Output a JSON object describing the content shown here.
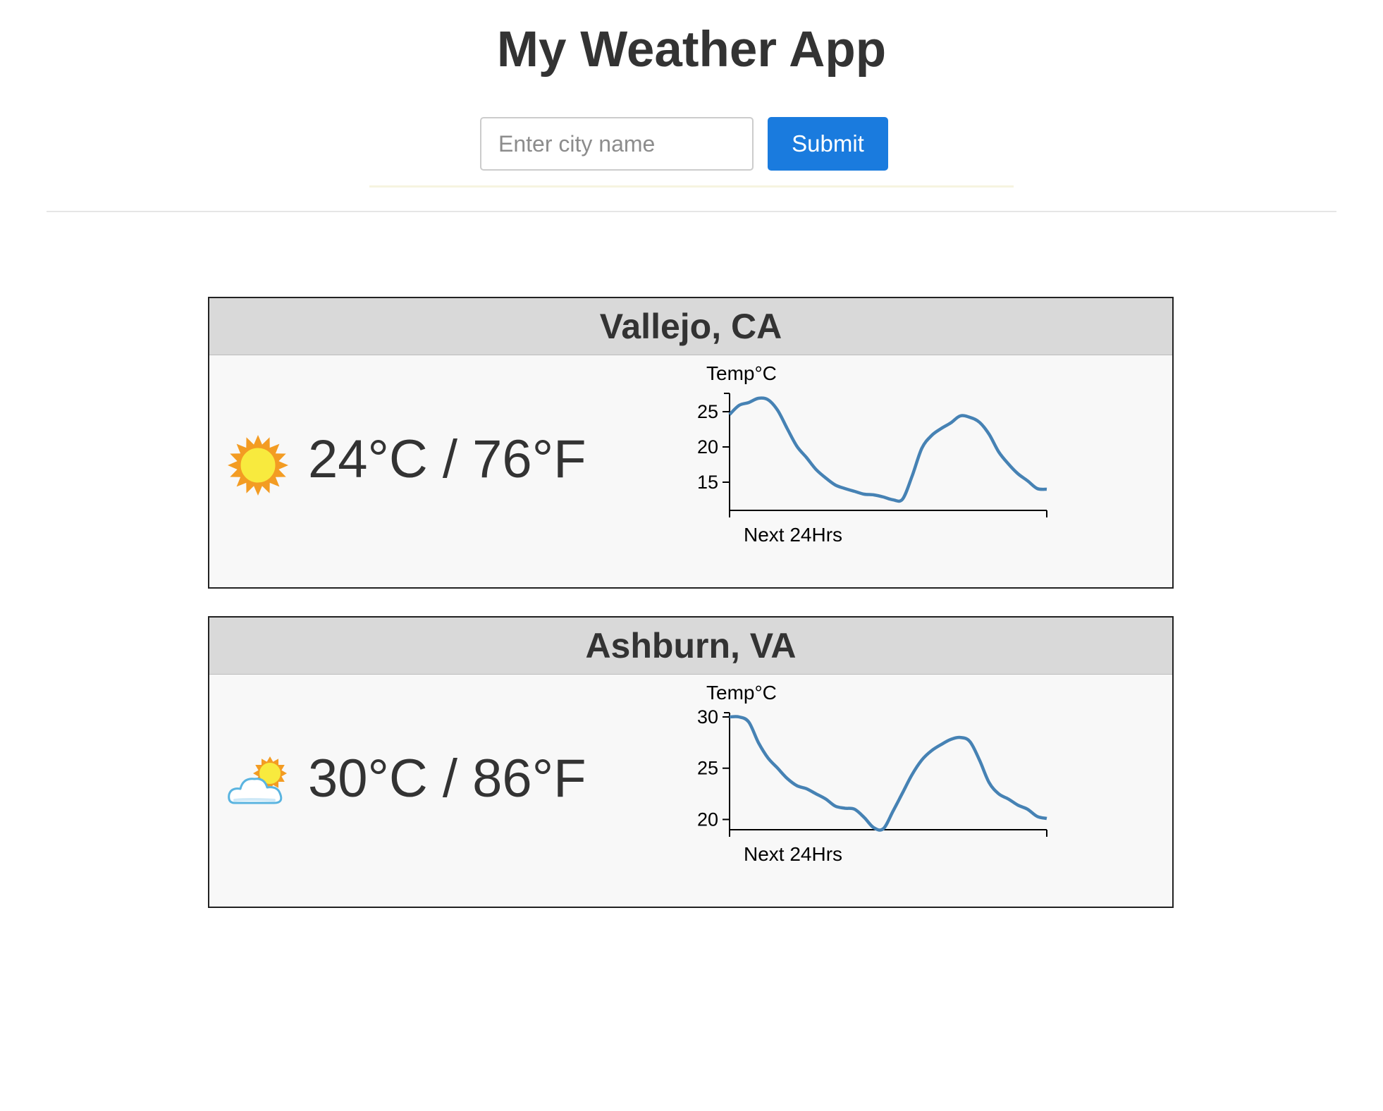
{
  "header": {
    "title": "My Weather App"
  },
  "search": {
    "placeholder": "Enter city name",
    "value": "",
    "submit_label": "Submit",
    "accent_color": "#1a7bde"
  },
  "cities": [
    {
      "name": "Vallejo, CA",
      "icon": "sun-icon",
      "temperature": "24°C / 76°F"
    },
    {
      "name": "Ashburn, VA",
      "icon": "partly-cloudy-icon",
      "temperature": "30°C / 86°F"
    }
  ],
  "chart_data": [
    {
      "type": "line",
      "ylabel": "Temp°C",
      "xlabel": "Next 24Hrs",
      "yticks": [
        15,
        20,
        25
      ],
      "ylim": [
        11,
        27
      ],
      "x": [
        0,
        3,
        6,
        9,
        12,
        15,
        18,
        21,
        24,
        27,
        30,
        33,
        36,
        39,
        42,
        45,
        48,
        51,
        54,
        57,
        60,
        63,
        66,
        69,
        72,
        75,
        78,
        81,
        84,
        87,
        90,
        93,
        96,
        99
      ],
      "series": [
        {
          "color": "#4682b4",
          "values": [
            24.6,
            25.9,
            26.3,
            26.9,
            26.7,
            25.2,
            22.6,
            20.1,
            18.5,
            16.8,
            15.6,
            14.6,
            14.1,
            13.7,
            13.3,
            13.2,
            12.9,
            12.5,
            12.6,
            15.9,
            19.8,
            21.6,
            22.6,
            23.4,
            24.4,
            24.2,
            23.5,
            21.8,
            19.3,
            17.6,
            16.2,
            15.2,
            14.1,
            14.0
          ]
        }
      ]
    },
    {
      "type": "line",
      "ylabel": "Temp°C",
      "xlabel": "Next 24Hrs",
      "yticks": [
        20,
        25,
        30
      ],
      "ylim": [
        19,
        30
      ],
      "x": [
        0,
        3,
        6,
        9,
        12,
        15,
        18,
        21,
        24,
        27,
        30,
        33,
        36,
        39,
        42,
        45,
        48,
        51,
        54,
        57,
        60,
        63,
        66,
        69,
        72,
        75,
        78,
        81,
        84,
        87,
        90,
        93,
        96,
        99
      ],
      "series": [
        {
          "color": "#4682b4",
          "values": [
            30.0,
            30.0,
            29.5,
            27.5,
            26.0,
            25.0,
            24.0,
            23.3,
            23.0,
            22.5,
            22.0,
            21.3,
            21.1,
            21.0,
            20.2,
            19.2,
            19.1,
            20.8,
            22.6,
            24.4,
            25.8,
            26.7,
            27.3,
            27.8,
            28.0,
            27.6,
            25.8,
            23.6,
            22.5,
            22.0,
            21.4,
            21.0,
            20.3,
            20.1
          ]
        }
      ]
    }
  ]
}
